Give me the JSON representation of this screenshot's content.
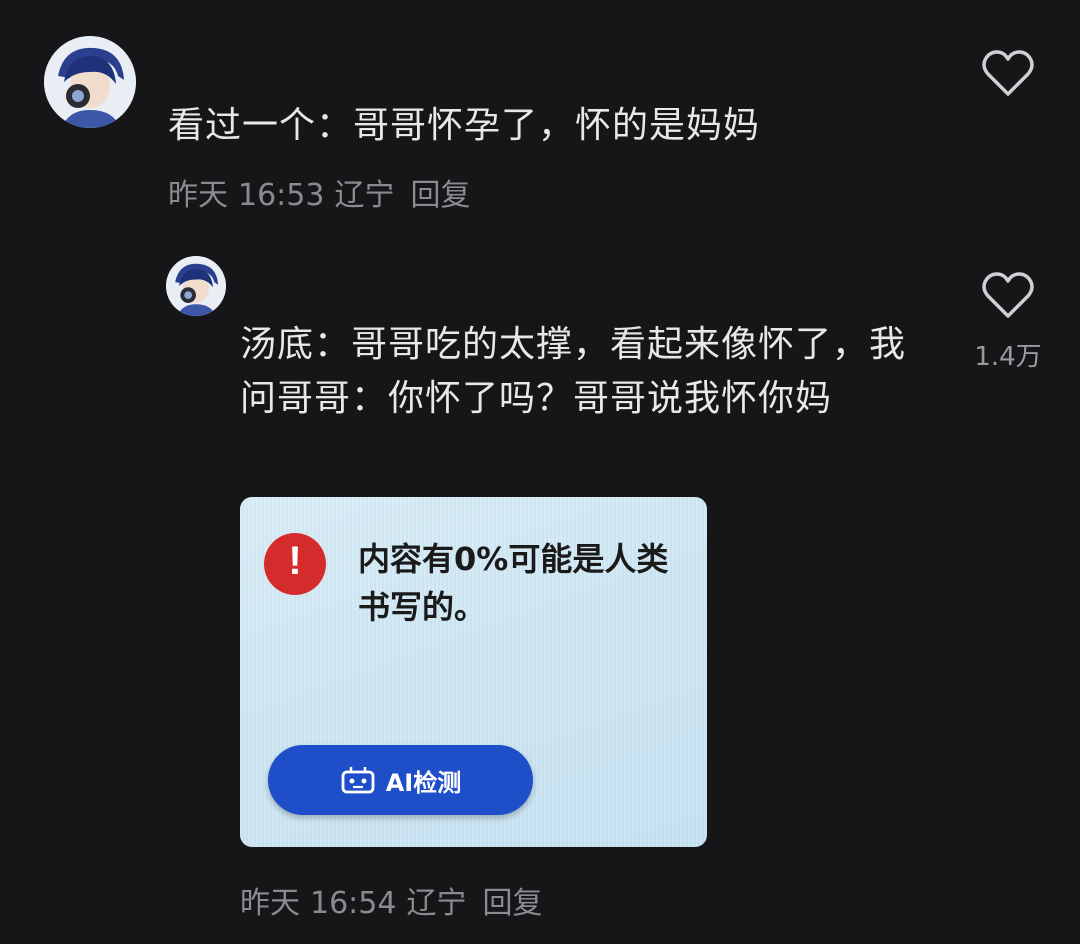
{
  "comments": [
    {
      "text": "看过一个：哥哥怀孕了，怀的是妈妈",
      "date": "昨天",
      "time": "16:53",
      "location": "辽宁",
      "reply_label": "回复"
    },
    {
      "text": "汤底：哥哥吃的太撑，看起来像怀了，我问哥哥：你怀了吗？哥哥说我怀你妈",
      "date": "昨天",
      "time": "16:54",
      "location": "辽宁",
      "reply_label": "回复",
      "like_count": "1.4万",
      "image": {
        "message": "内容有0%可能是人类书写的。",
        "button_label": "AI检测",
        "alert_icon": "exclamation-icon",
        "button_icon": "robot-icon"
      }
    }
  ],
  "colors": {
    "background": "#161619",
    "text": "#e8e8e8",
    "meta": "#8a8a8f",
    "alert_red": "#d42c2c",
    "button_blue": "#1e4fc9"
  }
}
